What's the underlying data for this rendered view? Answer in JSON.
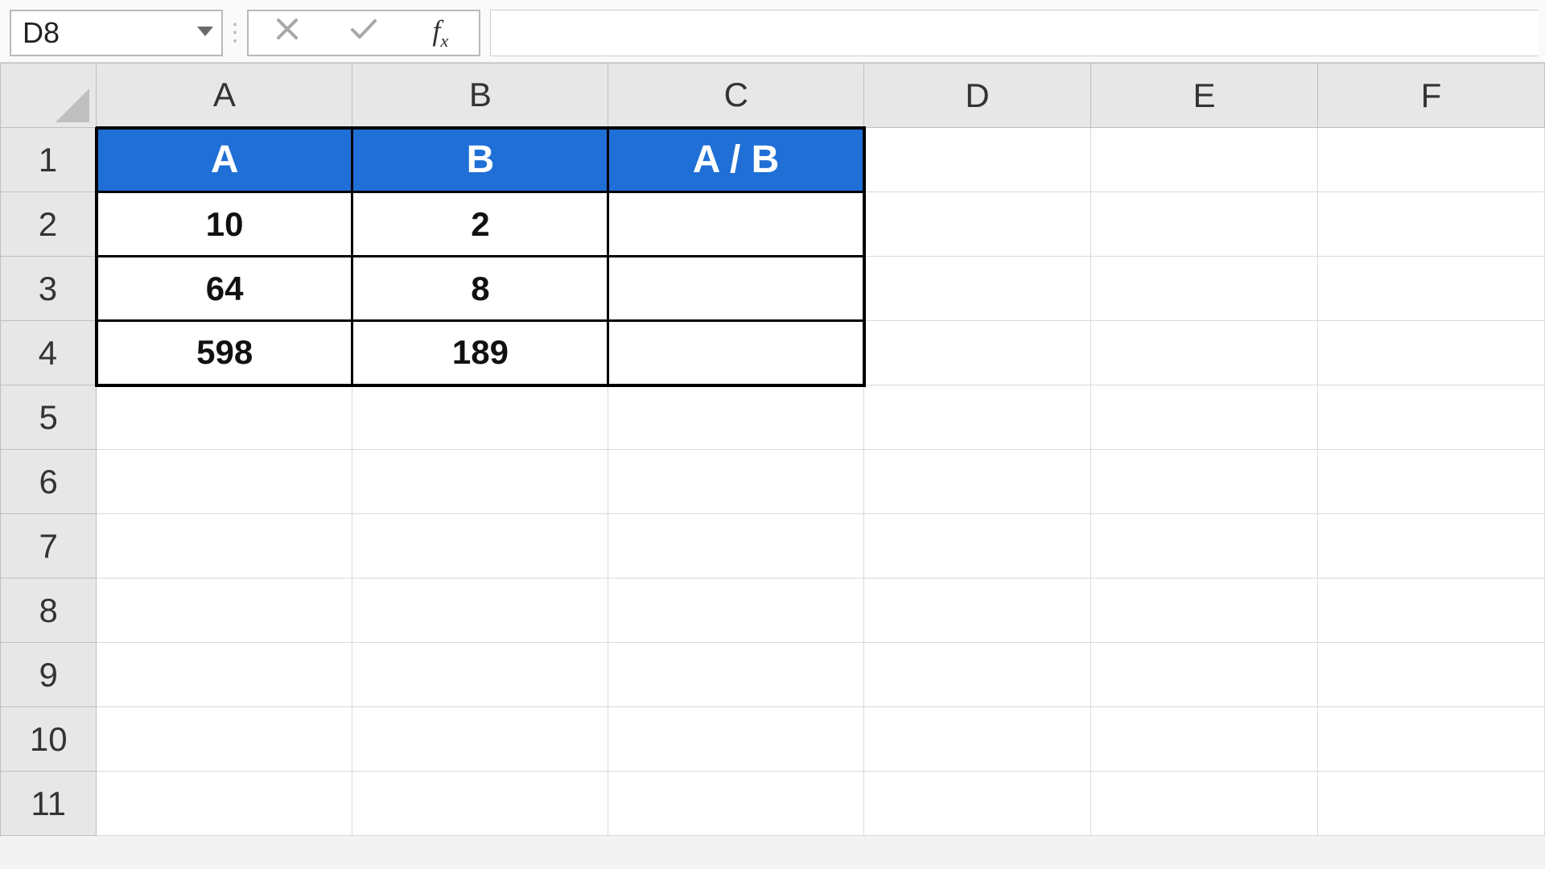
{
  "formula_bar": {
    "name_box_value": "D8",
    "cancel_tip": "Cancel",
    "enter_tip": "Enter",
    "fx_tip": "Insert Function",
    "formula_value": ""
  },
  "columns": [
    "A",
    "B",
    "C",
    "D",
    "E",
    "F"
  ],
  "row_headers": [
    "1",
    "2",
    "3",
    "4",
    "5",
    "6",
    "7",
    "8",
    "9",
    "10",
    "11"
  ],
  "table": {
    "header_bg": "#1f6fd6",
    "header_fg": "#ffffff",
    "headers": [
      "A",
      "B",
      "A / B"
    ],
    "rows": [
      {
        "A": "10",
        "B": "2",
        "C": ""
      },
      {
        "A": "64",
        "B": "8",
        "C": ""
      },
      {
        "A": "598",
        "B": "189",
        "C": ""
      }
    ]
  },
  "active_cell": "D8",
  "chart_data": {
    "type": "table",
    "title": "",
    "columns": [
      "A",
      "B",
      "A / B"
    ],
    "rows": [
      [
        10,
        2,
        null
      ],
      [
        64,
        8,
        null
      ],
      [
        598,
        189,
        null
      ]
    ]
  }
}
